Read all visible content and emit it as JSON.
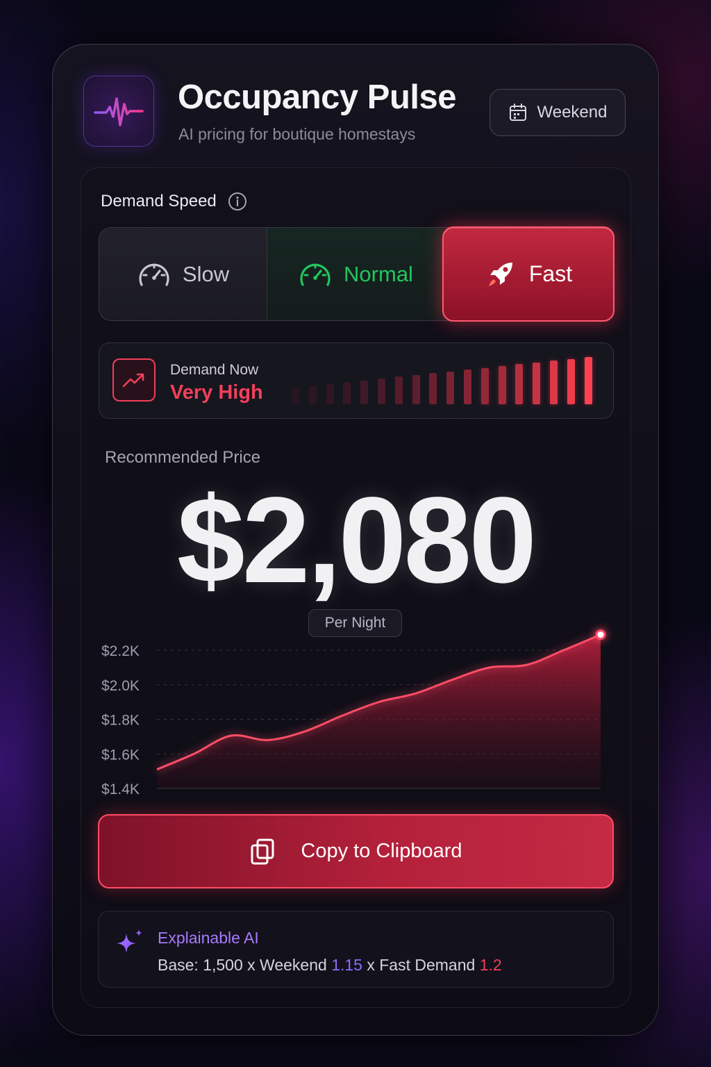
{
  "app": {
    "title": "Occupancy Pulse",
    "subtitle": "AI pricing for boutique homestays",
    "logo_icon": "pulse-icon"
  },
  "header": {
    "period_button": {
      "label": "Weekend",
      "icon": "calendar-icon"
    }
  },
  "demand_speed": {
    "label": "Demand Speed",
    "info_icon": "info-icon",
    "options": [
      {
        "label": "Slow",
        "icon": "speedometer-icon",
        "color": "#c9c8d2"
      },
      {
        "label": "Normal",
        "icon": "speedometer-icon",
        "color": "#22c55e"
      },
      {
        "label": "Fast",
        "icon": "rocket-icon",
        "color": "#ffffff",
        "selected": true
      }
    ]
  },
  "demand_now": {
    "label": "Demand Now",
    "value": "Very High",
    "icon": "trend-up-icon",
    "level_bars_total": 18,
    "level_bars_active": 18,
    "accent": "#f0405a"
  },
  "price": {
    "label": "Recommended Price",
    "value": "$2,080",
    "unit": "Per Night"
  },
  "chart_data": {
    "type": "area",
    "title": "",
    "xlabel": "",
    "ylabel": "",
    "y_tick_labels": [
      "$2.2K",
      "$2.0K",
      "$1.8K",
      "$1.6K",
      "$1.4K"
    ],
    "ylim": [
      1400,
      2200
    ],
    "grid": true,
    "x": [
      0,
      1,
      2,
      3,
      4,
      5,
      6,
      7,
      8,
      9,
      10,
      11,
      12
    ],
    "values": [
      1510,
      1600,
      1705,
      1680,
      1730,
      1820,
      1900,
      1950,
      2030,
      2100,
      2115,
      2200,
      2290
    ],
    "color": "#ff4d66",
    "end_marker": true
  },
  "actions": {
    "copy_label": "Copy to Clipboard",
    "copy_icon": "copy-icon"
  },
  "explain": {
    "icon": "sparkle-icon",
    "title": "Explainable AI",
    "base_text": "Base: 1,500 x Weekend",
    "weekend_multiplier": "1.15",
    "demand_text": "x Fast Demand",
    "demand_multiplier": "1.2"
  }
}
